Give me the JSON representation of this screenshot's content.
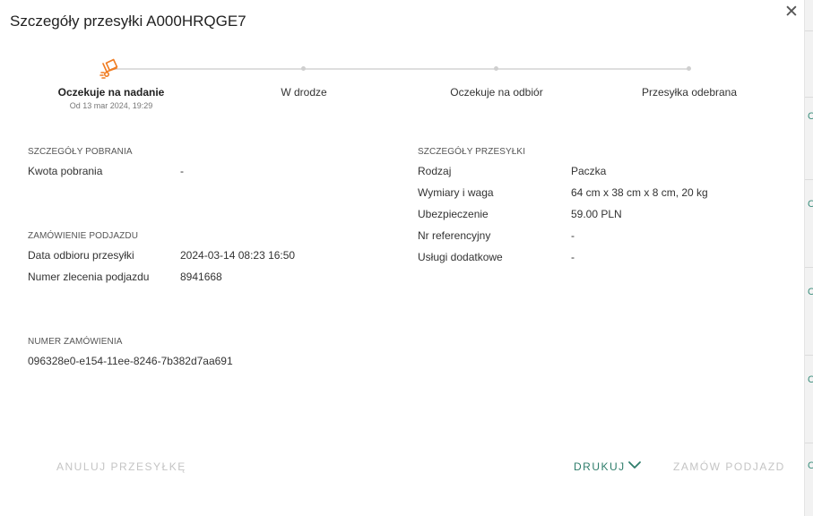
{
  "modal": {
    "title": "Szczegóły przesyłki A000HRQGE7",
    "close_icon": "close-icon"
  },
  "progress": {
    "current_step": 0,
    "accent_color": "#f07c21",
    "steps": [
      {
        "label": "Oczekuje na nadanie",
        "sub": "Od 13 mar 2024, 19:29"
      },
      {
        "label": "W drodze"
      },
      {
        "label": "Oczekuje na odbiór"
      },
      {
        "label": "Przesyłka odebrana"
      }
    ]
  },
  "pobranie": {
    "header": "SZCZEGÓŁY POBRANIA",
    "rows": [
      {
        "label": "Kwota pobrania",
        "value": "-"
      }
    ]
  },
  "podjazd": {
    "header": "ZAMÓWIENIE PODJAZDU",
    "rows": [
      {
        "label": "Data odbioru przesyłki",
        "value": "2024-03-14 08:23 16:50"
      },
      {
        "label": "Numer zlecenia podjazdu",
        "value": "8941668"
      }
    ]
  },
  "zamowienie": {
    "header": "NUMER ZAMÓWIENIA",
    "value": "096328e0-e154-11ee-8246-7b382d7aa691"
  },
  "przesylka": {
    "header": "SZCZEGÓŁY PRZESYŁKI",
    "rows": [
      {
        "label": "Rodzaj",
        "value": "Paczka"
      },
      {
        "label": "Wymiary i waga",
        "value": "64 cm x 38 cm x 8 cm, 20 kg"
      },
      {
        "label": "Ubezpieczenie",
        "value": "59.00 PLN"
      },
      {
        "label": "Nr referencyjny",
        "value": "-"
      },
      {
        "label": "Usługi dodatkowe",
        "value": "-"
      }
    ]
  },
  "footer": {
    "cancel_label": "ANULUJ PRZESYŁKĘ",
    "print_label": "DRUKUJ",
    "order_pickup_label": "ZAMÓW PODJAZD"
  }
}
